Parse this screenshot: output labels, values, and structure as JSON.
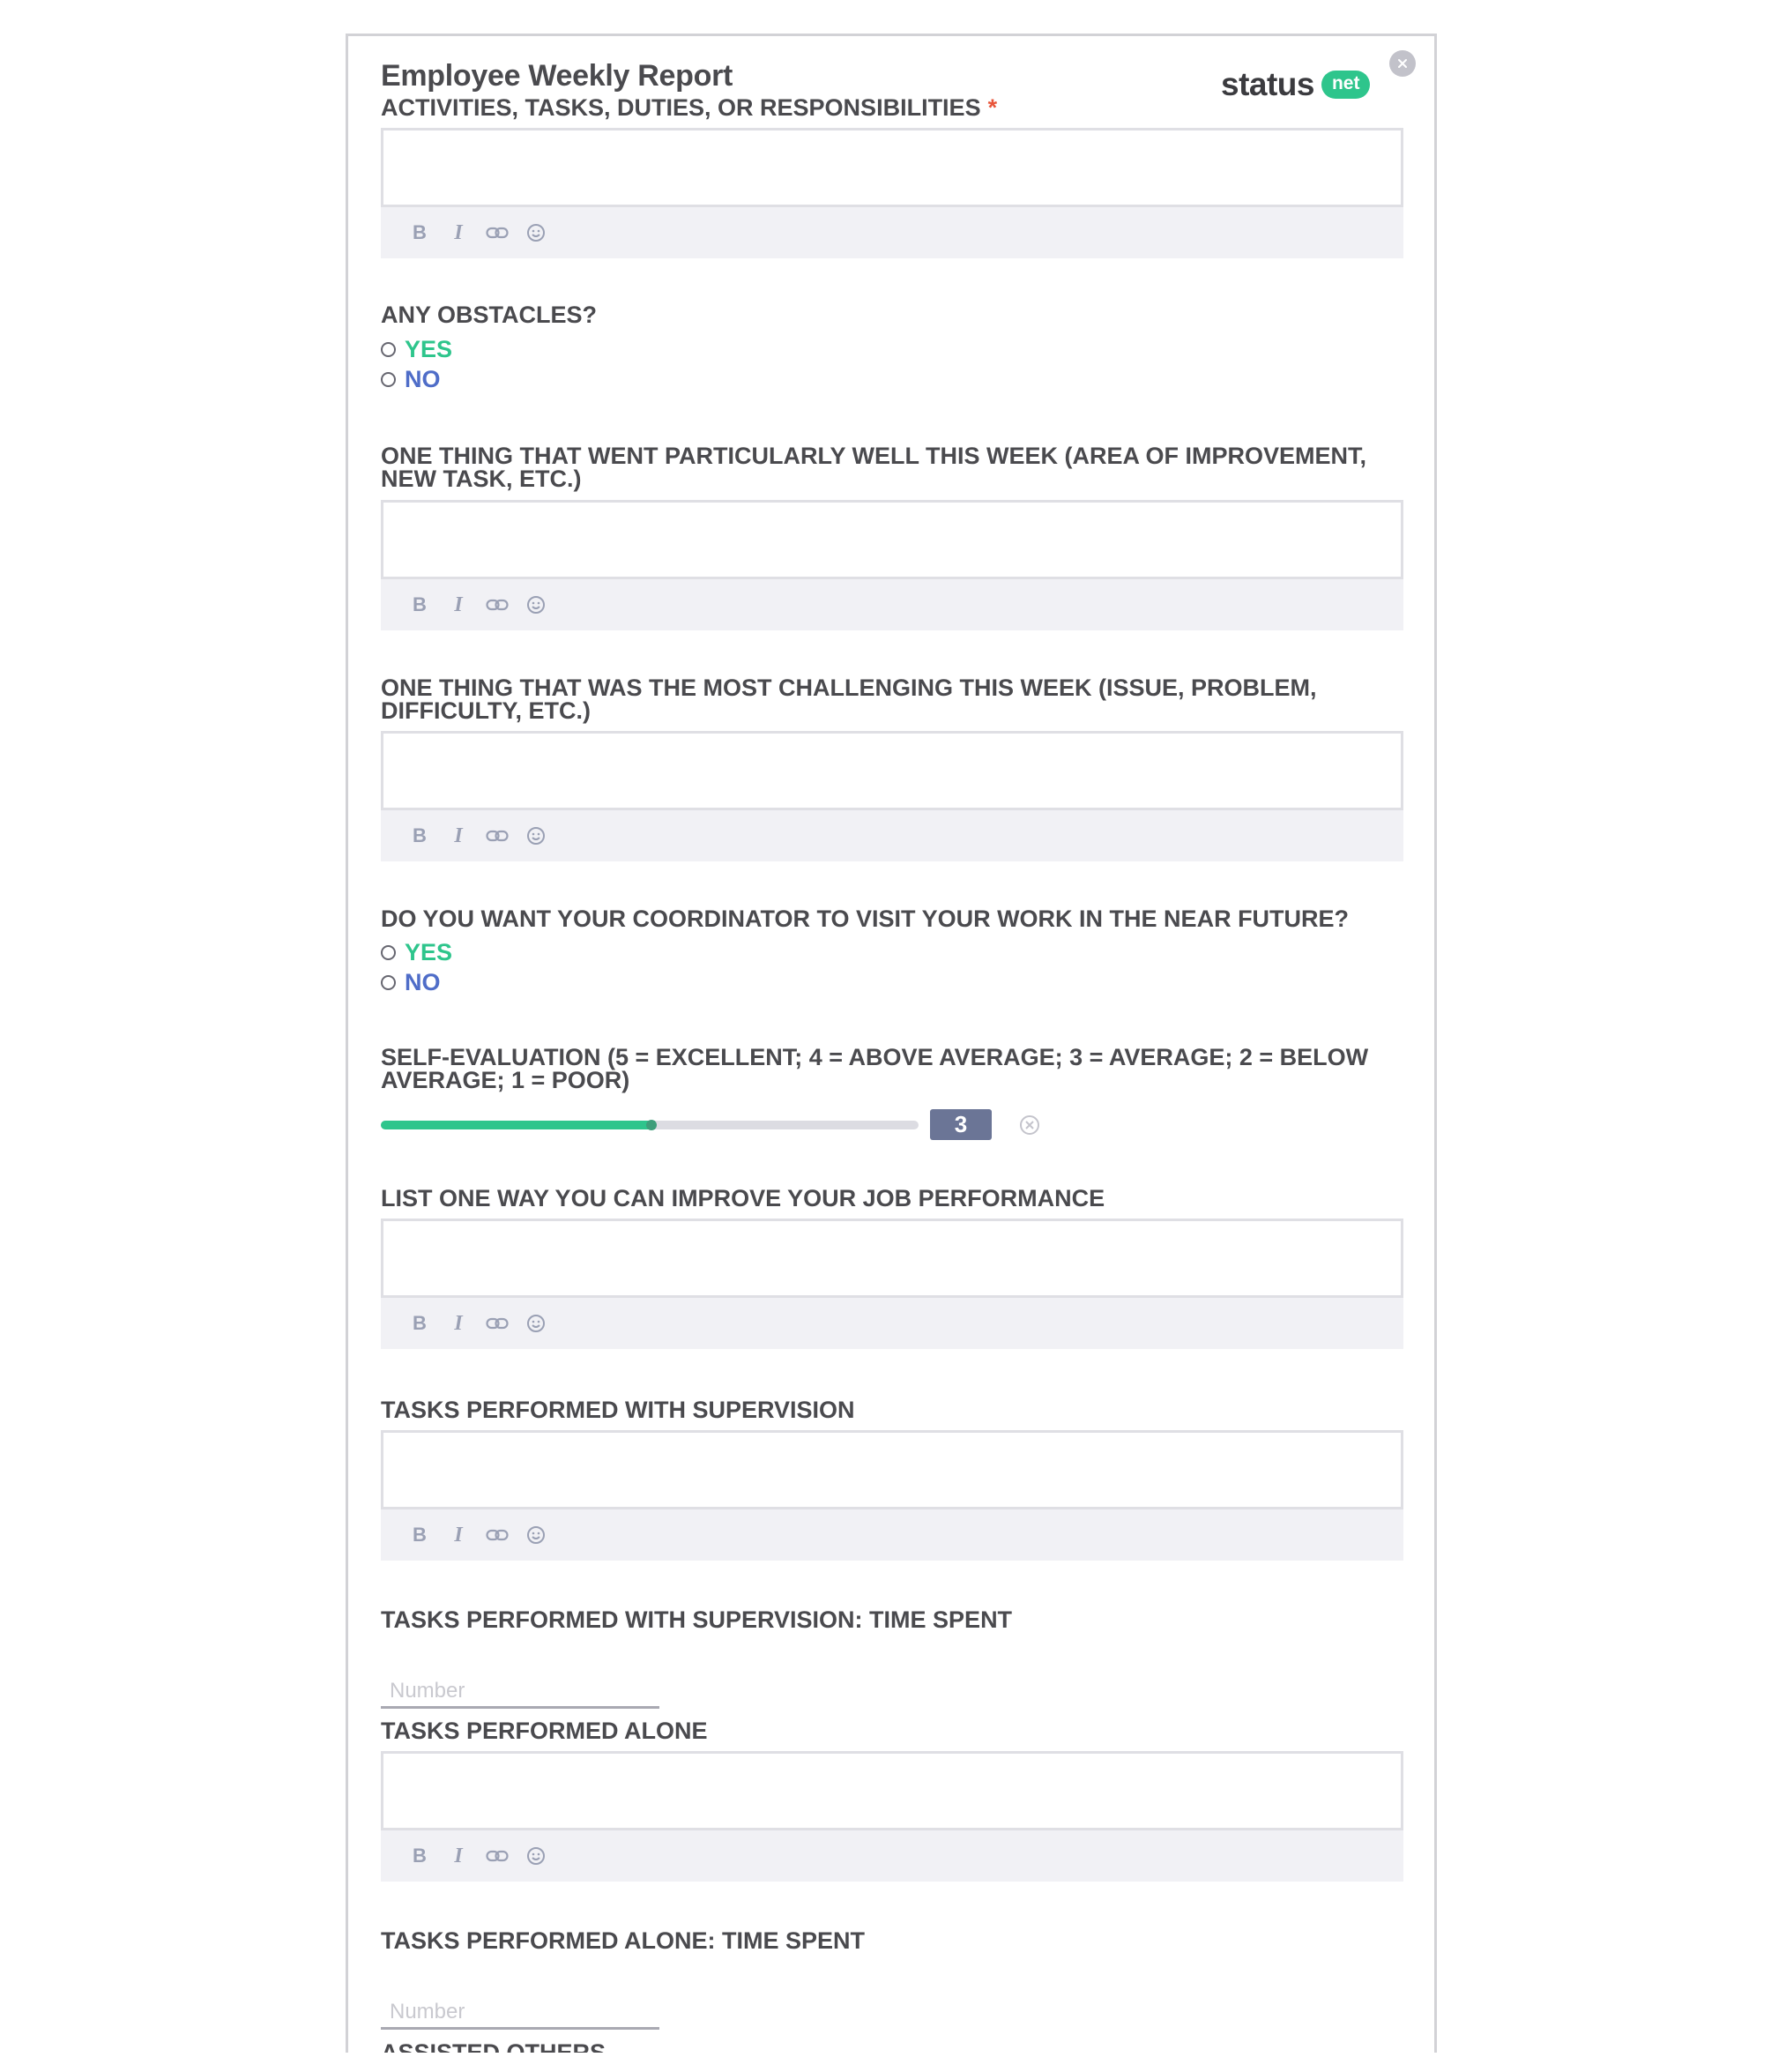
{
  "form": {
    "title": "Employee Weekly Report",
    "brand": {
      "word": "status",
      "pill": "net"
    }
  },
  "fields": {
    "activities": {
      "label": "ACTIVITIES, TASKS, DUTIES, OR RESPONSIBILITIES",
      "required_mark": "*"
    },
    "obstacles": {
      "label": "ANY OBSTACLES?",
      "options": [
        "YES",
        "NO"
      ]
    },
    "went_well": {
      "label": "ONE THING THAT WENT PARTICULARLY WELL THIS WEEK (AREA OF IMPROVEMENT, NEW TASK, ETC.)"
    },
    "challenging": {
      "label": "ONE THING THAT WAS THE MOST CHALLENGING THIS WEEK (ISSUE, PROBLEM, DIFFICULTY, ETC.)"
    },
    "coordinator_visit": {
      "label": "DO YOU WANT YOUR COORDINATOR TO VISIT YOUR WORK IN THE NEAR FUTURE?",
      "options": [
        "YES",
        "NO"
      ]
    },
    "self_evaluation": {
      "label": "SELF-EVALUATION (5 = EXCELLENT; 4 = ABOVE AVERAGE; 3 = AVERAGE; 2 = BELOW AVERAGE; 1 = POOR)",
      "value": "3",
      "fill_fraction": 0.51
    },
    "improve": {
      "label": "LIST ONE WAY YOU CAN IMPROVE YOUR JOB PERFORMANCE"
    },
    "supervised_tasks": {
      "label": "TASKS PERFORMED WITH SUPERVISION"
    },
    "supervised_time": {
      "label": "TASKS PERFORMED WITH SUPERVISION: TIME SPENT",
      "placeholder": "Number"
    },
    "alone_tasks": {
      "label": "TASKS PERFORMED ALONE"
    },
    "alone_time": {
      "label": "TASKS PERFORMED ALONE: TIME SPENT",
      "placeholder": "Number"
    },
    "assisted": {
      "label": "ASSISTED OTHERS"
    }
  },
  "toolbar": {
    "bold": "B",
    "italic": "I",
    "link_icon": "link-icon",
    "emoji_icon": "smiley-icon"
  },
  "colors": {
    "accent_green": "#2ec58c",
    "no_blue": "#4f6dc8",
    "required_red": "#e8553a",
    "slider_badge": "#6b7596"
  }
}
